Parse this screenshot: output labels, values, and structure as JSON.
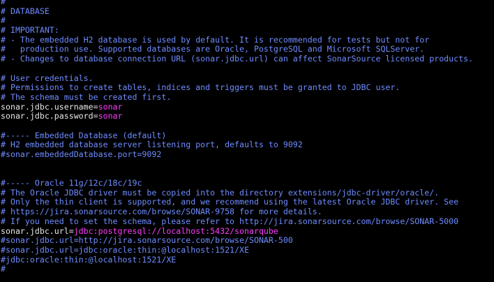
{
  "colors": {
    "background": "#000000",
    "comment": "#6F8CFF",
    "plain": "#E8E8E8",
    "value": "#FF3CFF"
  },
  "lines": [
    {
      "type": "comment",
      "text": "#"
    },
    {
      "type": "comment",
      "text": "# DATABASE"
    },
    {
      "type": "comment",
      "text": "#"
    },
    {
      "type": "comment",
      "text": "# IMPORTANT:"
    },
    {
      "type": "comment",
      "text": "# - The embedded H2 database is used by default. It is recommended for tests but not for"
    },
    {
      "type": "comment",
      "text": "#   production use. Supported databases are Oracle, PostgreSQL and Microsoft SQLServer."
    },
    {
      "type": "comment",
      "text": "# - Changes to database connection URL (sonar.jdbc.url) can affect SonarSource licensed products."
    },
    {
      "type": "blank",
      "text": ""
    },
    {
      "type": "comment",
      "text": "# User credentials."
    },
    {
      "type": "comment",
      "text": "# Permissions to create tables, indices and triggers must be granted to JDBC user."
    },
    {
      "type": "comment",
      "text": "# The schema must be created first."
    },
    {
      "type": "setting",
      "key": "sonar.jdbc.username=",
      "value": "sonar"
    },
    {
      "type": "setting",
      "key": "sonar.jdbc.password=",
      "value": "sonar"
    },
    {
      "type": "blank",
      "text": ""
    },
    {
      "type": "comment",
      "text": "#----- Embedded Database (default)"
    },
    {
      "type": "comment",
      "text": "# H2 embedded database server listening port, defaults to 9092"
    },
    {
      "type": "comment",
      "text": "#sonar.embeddedDatabase.port=9092"
    },
    {
      "type": "blank",
      "text": ""
    },
    {
      "type": "blank",
      "text": ""
    },
    {
      "type": "comment",
      "text": "#----- Oracle 11g/12c/18c/19c"
    },
    {
      "type": "comment",
      "text": "# The Oracle JDBC driver must be copied into the directory extensions/jdbc-driver/oracle/."
    },
    {
      "type": "comment",
      "text": "# Only the thin client is supported, and we recommend using the latest Oracle JDBC driver. See"
    },
    {
      "type": "comment",
      "text": "# https://jira.sonarsource.com/browse/SONAR-9758 for more details."
    },
    {
      "type": "comment",
      "text": "# If you need to set the schema, please refer to http://jira.sonarsource.com/browse/SONAR-5000"
    },
    {
      "type": "setting",
      "key": "sonar.jdbc.url=",
      "value": "jdbc:postgresql://localhost:5432/sonarqube"
    },
    {
      "type": "comment",
      "text": "#sonar.jdbc.url=http://jira.sonarsource.com/browse/SONAR-500"
    },
    {
      "type": "comment",
      "text": "#sonar.jdbc.url=jdbc:oracle:thin:@localhost:1521/XE"
    },
    {
      "type": "comment",
      "text": "#jdbc:oracle:thin:@localhost:1521/XE"
    },
    {
      "type": "comment",
      "text": "#"
    }
  ]
}
